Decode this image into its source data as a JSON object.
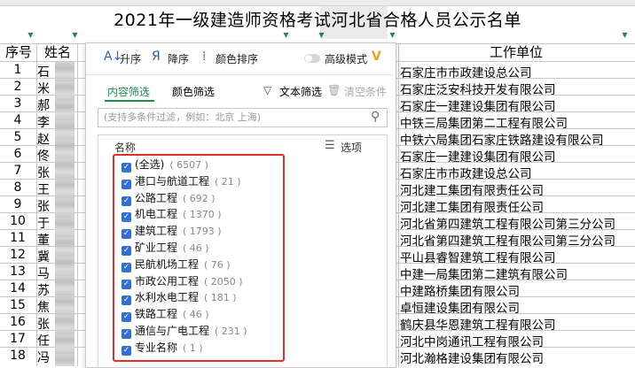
{
  "sheet": {
    "title": "2021年一级建造师资格考试河北省合格人员公示名单",
    "headers": {
      "seq": "序号",
      "name": "姓名",
      "company": "工作单位"
    },
    "rows": [
      {
        "seq": "1",
        "name": "石",
        "company": "石家庄市市政建设总公司"
      },
      {
        "seq": "2",
        "name": "米",
        "company": "石家庄泛安科技开发有限公司"
      },
      {
        "seq": "3",
        "name": "郝",
        "company": "石家庄一建建设集团有限公司"
      },
      {
        "seq": "4",
        "name": "李",
        "company": "中铁三局集团第二工程有限公司"
      },
      {
        "seq": "5",
        "name": "赵",
        "company": "中铁六局集团石家庄铁路建设有限公司"
      },
      {
        "seq": "6",
        "name": "佟",
        "company": "石家庄一建建设集团有限公司"
      },
      {
        "seq": "7",
        "name": "张",
        "company": "石家庄市市政建设总公司"
      },
      {
        "seq": "8",
        "name": "王",
        "company": "河北建工集团有限责任公司"
      },
      {
        "seq": "9",
        "name": "张",
        "company": "河北建工集团有限责任公司"
      },
      {
        "seq": "10",
        "name": "于",
        "company": "河北省第四建筑工程有限公司第三分公司"
      },
      {
        "seq": "11",
        "name": "董",
        "company": "河北省第四建筑工程有限公司第三分公司"
      },
      {
        "seq": "12",
        "name": "冀",
        "company": "平山县睿智建筑工程有限公司"
      },
      {
        "seq": "13",
        "name": "马",
        "company": "中建一局集团第二建筑有限公司"
      },
      {
        "seq": "14",
        "name": "苏",
        "company": "中建路桥集团有限公司"
      },
      {
        "seq": "15",
        "name": "焦",
        "company": "卓恒建设集团有限公司"
      },
      {
        "seq": "16",
        "name": "张",
        "company": "鹤庆县华恩建筑工程有限公司"
      },
      {
        "seq": "17",
        "name": "任",
        "company": "河北中岗通讯工程有限公司"
      },
      {
        "seq": "18",
        "name": "冯",
        "company": "河北瀚格建设集团有限公司"
      }
    ]
  },
  "popup": {
    "toolbar": {
      "asc": "升序",
      "desc": "降序",
      "color_sort": "颜色排序",
      "advanced": "高级模式"
    },
    "tabs": {
      "content": "内容筛选",
      "color": "颜色筛选"
    },
    "actions": {
      "text_filter": "文本筛选",
      "clear": "清空条件"
    },
    "search_placeholder": "(支持多条件过滤，例如：北京 上海)",
    "list_header": "名称",
    "options_label": "选项",
    "items": [
      {
        "label": "(全选)",
        "count": "( 6507 )"
      },
      {
        "label": "港口与航道工程",
        "count": "( 21 )"
      },
      {
        "label": "公路工程",
        "count": "( 692 )"
      },
      {
        "label": "机电工程",
        "count": "( 1370 )"
      },
      {
        "label": "建筑工程",
        "count": "( 1793 )"
      },
      {
        "label": "矿业工程",
        "count": "( 46 )"
      },
      {
        "label": "民航机场工程",
        "count": "( 76 )"
      },
      {
        "label": "市政公用工程",
        "count": "( 2050 )"
      },
      {
        "label": "水利水电工程",
        "count": "( 181 )"
      },
      {
        "label": "铁路工程",
        "count": "( 46 )"
      },
      {
        "label": "通信与广电工程",
        "count": "( 231 )"
      },
      {
        "label": "专业名称",
        "count": "( 1 )"
      }
    ]
  },
  "colors": {
    "accent_green": "#1f8a4c",
    "checkbox_blue": "#2f6fd6",
    "highlight_red": "#e0302b"
  }
}
